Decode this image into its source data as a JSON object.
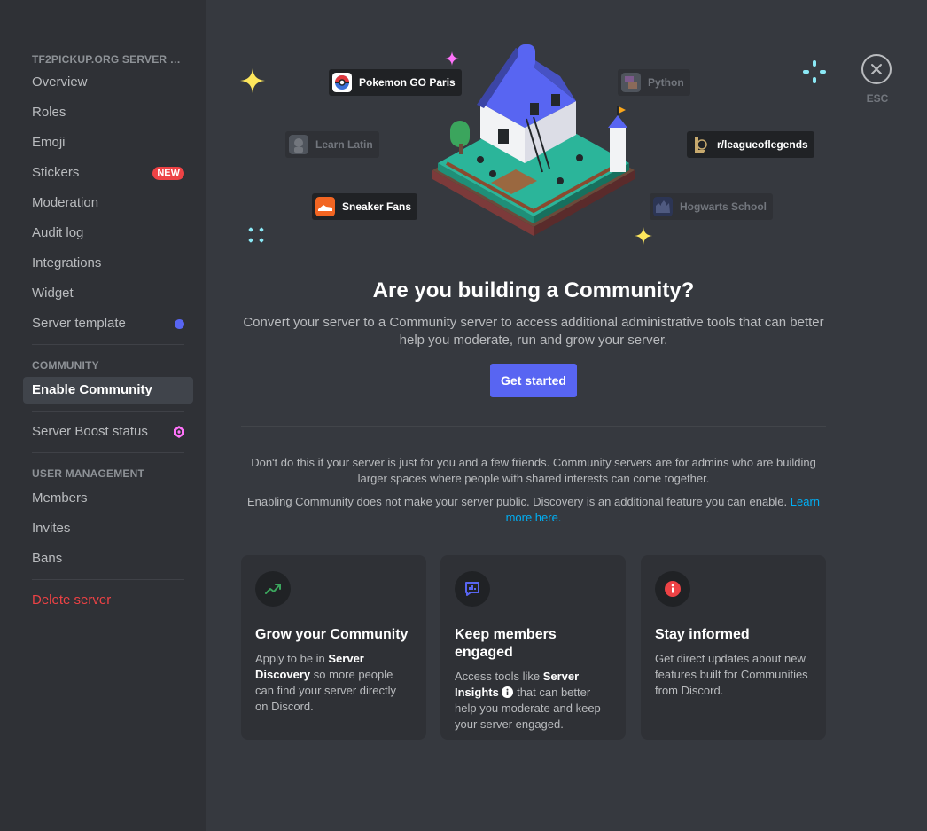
{
  "sidebar": {
    "server_section": "TF2PICKUP.ORG SERVER TE...",
    "server_items": [
      "Overview",
      "Roles",
      "Emoji",
      "Stickers",
      "Moderation",
      "Audit log",
      "Integrations",
      "Widget",
      "Server template"
    ],
    "stickers_badge": "NEW",
    "community_section": "COMMUNITY",
    "enable_community": "Enable Community",
    "boost_status": "Server Boost status",
    "user_section": "USER MANAGEMENT",
    "user_items": [
      "Members",
      "Invites",
      "Bans"
    ],
    "delete_server": "Delete server"
  },
  "close": {
    "esc_label": "ESC"
  },
  "chips": {
    "pokemon": "Pokemon GO Paris",
    "python": "Python",
    "latin": "Learn Latin",
    "league": "r/leagueoflegends",
    "sneaker": "Sneaker Fans",
    "hogwarts": "Hogwarts School"
  },
  "hero": {
    "title": "Are you building a Community?",
    "subtitle": "Convert your server to a Community server to access additional administrative tools that can better help you moderate, run and grow your server.",
    "cta": "Get started"
  },
  "notes": {
    "note1": "Don't do this if your server is just for you and a few friends. Community servers are for admins who are building larger spaces where people with shared interests can come together.",
    "note2_text": "Enabling Community does not make your server public. Discovery is an additional feature you can enable.",
    "note2_link": "Learn more here."
  },
  "cards": {
    "grow": {
      "title": "Grow your Community",
      "b1": "Apply to be in ",
      "s1": "Server Discovery",
      "b2": " so more people can find your server directly on Discord."
    },
    "keep": {
      "title": "Keep members engaged",
      "b1": "Access tools like ",
      "s1": "Server Insights",
      "b2": " that can better help you moderate and keep your server engaged."
    },
    "stay": {
      "title": "Stay informed",
      "body": "Get direct updates about new features built for Communities from Discord."
    }
  },
  "colors": {
    "accent": "#5865f2",
    "danger": "#ed4245",
    "link": "#00aff4",
    "grow_icon": "#3ba55d",
    "keep_icon": "#5865f2",
    "stay_icon": "#ed4245"
  }
}
